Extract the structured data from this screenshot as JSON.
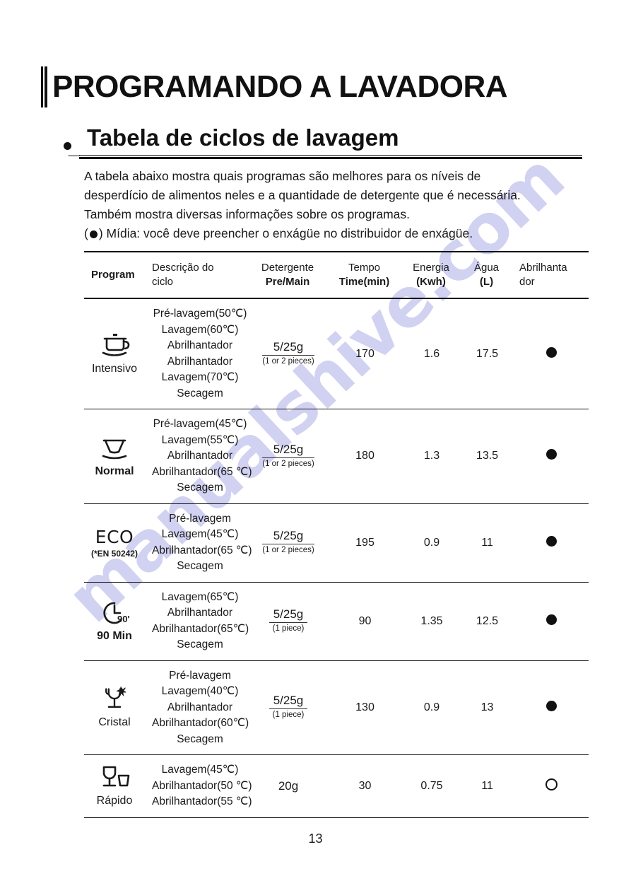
{
  "document": {
    "title": "PROGRAMANDO A LAVADORA",
    "subtitle": "Tabela de ciclos de lavagem",
    "page_number": "13",
    "watermark": "manualshive.com",
    "watermark_color": "#c9caf0"
  },
  "intro": {
    "line1": "A tabela abaixo mostra quais programas são melhores para os níveis de",
    "line2": "desperdício de alimentos neles e a quantidade de detergente que é necessária.",
    "line3": "Também mostra diversas informações sobre os programas.",
    "line4_before": "(",
    "line4_after": ") Mídia: você deve preencher o enxágüe no distribuidor de enxágüe."
  },
  "table": {
    "headers": {
      "program": "Program",
      "description_l1": "Descrição do",
      "description_l2": "ciclo",
      "detergent_l1": "Detergente",
      "detergent_l2": "Pre/Main",
      "time_l1": "Tempo",
      "time_l2": "Time(min)",
      "energy_l1": "Energia",
      "energy_l2": "(Kwh)",
      "water_l1": "Água",
      "water_l2": "(L)",
      "rinse_l1": "Abrilhanta",
      "rinse_l2": "dor"
    },
    "rows": [
      {
        "icon": "pot-icon",
        "program": "Intensivo",
        "program_bold": false,
        "steps": [
          "Pré-lavagem(50℃)",
          "Lavagem(60℃)",
          "Abrilhantador",
          "Abrilhantador",
          "Lavagem(70℃)",
          "Secagem"
        ],
        "detergent_main": "5/25g",
        "detergent_sub": "(1 or 2 pieces)",
        "time": "170",
        "energy": "1.6",
        "water": "17.5",
        "rinse_aid": "filled"
      },
      {
        "icon": "bowl-icon",
        "program": "Normal",
        "program_bold": true,
        "steps": [
          "Pré-lavagem(45℃)",
          "Lavagem(55℃)",
          "Abrilhantador",
          "Abrilhantador(65 ℃)",
          "Secagem"
        ],
        "detergent_main": "5/25g",
        "detergent_sub": "(1 or 2 pieces)",
        "time": "180",
        "energy": "1.3",
        "water": "13.5",
        "rinse_aid": "filled"
      },
      {
        "icon": "eco-text-icon",
        "program": "ECO",
        "program_sub": "(*EN 50242)",
        "program_bold": false,
        "steps": [
          "Pré-lavagem",
          "Lavagem(45℃)",
          "Abrilhantador(65 ℃)",
          "Secagem"
        ],
        "detergent_main": "5/25g",
        "detergent_sub": "(1 or 2 pieces)",
        "time": "195",
        "energy": "0.9",
        "water": "11",
        "rinse_aid": "filled"
      },
      {
        "icon": "clock-90-icon",
        "program": "90 Min",
        "program_bold": true,
        "steps": [
          "Lavagem(65℃)",
          "Abrilhantador",
          "Abrilhantador(65℃)",
          "Secagem"
        ],
        "detergent_main": "5/25g",
        "detergent_sub": "(1  piece)",
        "time": "90",
        "energy": "1.35",
        "water": "12.5",
        "rinse_aid": "filled"
      },
      {
        "icon": "crystal-glass-icon",
        "program": "Cristal",
        "program_bold": false,
        "steps": [
          "Pré-lavagem",
          "Lavagem(40℃)",
          "Abrilhantador",
          "Abrilhantador(60℃)",
          "Secagem"
        ],
        "detergent_main": "5/25g",
        "detergent_sub": "(1  piece)",
        "time": "130",
        "energy": "0.9",
        "water": "13",
        "rinse_aid": "filled"
      },
      {
        "icon": "glass-tumbler-icon",
        "program": "Rápido",
        "program_bold": false,
        "steps": [
          "Lavagem(45℃)",
          "Abrilhantador(50 ℃)",
          "Abrilhantador(55 ℃)"
        ],
        "detergent_plain": "20g",
        "time": "30",
        "energy": "0.75",
        "water": "11",
        "rinse_aid": "open"
      }
    ]
  }
}
